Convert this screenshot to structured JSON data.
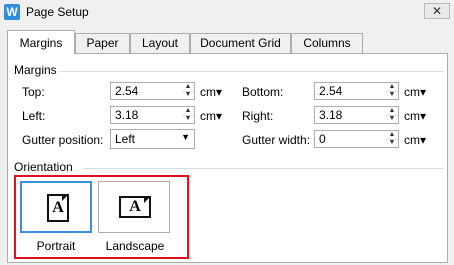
{
  "window": {
    "app_icon": "W",
    "title": "Page Setup",
    "close_label": "✕"
  },
  "tabs": [
    {
      "label": "Margins",
      "active": true
    },
    {
      "label": "Paper",
      "active": false
    },
    {
      "label": "Layout",
      "active": false
    },
    {
      "label": "Document Grid",
      "active": false
    },
    {
      "label": "Columns",
      "active": false
    }
  ],
  "margins": {
    "group_label": "Margins",
    "top": {
      "label": "Top:",
      "value": "2.54",
      "unit": "cm▾"
    },
    "bottom": {
      "label": "Bottom:",
      "value": "2.54",
      "unit": "cm▾"
    },
    "left": {
      "label": "Left:",
      "value": "3.18",
      "unit": "cm▾"
    },
    "right": {
      "label": "Right:",
      "value": "3.18",
      "unit": "cm▾"
    },
    "gutter_position": {
      "label": "Gutter position:",
      "value": "Left"
    },
    "gutter_width": {
      "label": "Gutter width:",
      "value": "0",
      "unit": "cm▾"
    }
  },
  "orientation": {
    "group_label": "Orientation",
    "icon_letter": "A",
    "portrait": {
      "label": "Portrait",
      "selected": true
    },
    "landscape": {
      "label": "Landscape",
      "selected": false
    }
  }
}
